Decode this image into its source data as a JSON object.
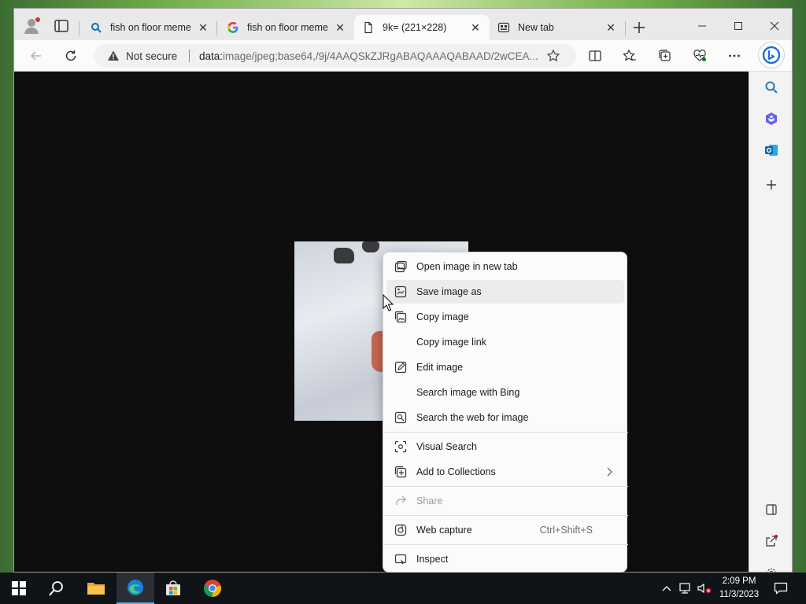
{
  "browser": {
    "tabs": [
      {
        "title": "fish on floor meme",
        "icon": "search-icon",
        "active": false
      },
      {
        "title": "fish on floor meme",
        "icon": "google-icon",
        "active": false
      },
      {
        "title": "9k= (221×228)",
        "icon": "page-icon",
        "active": true
      },
      {
        "title": "New tab",
        "icon": "new-tab-page-icon",
        "active": false
      }
    ],
    "address": {
      "security_label": "Not secure",
      "url_scheme": "data:",
      "url_rest": "image/jpeg;base64,/9j/4AAQSkZJRgABAQAAAQABAAD/2wCEA..."
    }
  },
  "context_menu": {
    "items": [
      {
        "label": "Open image in new tab",
        "icon": "open-in-new-tab-icon"
      },
      {
        "label": "Save image as",
        "icon": "save-image-icon",
        "hover": true
      },
      {
        "label": "Copy image",
        "icon": "copy-image-icon"
      },
      {
        "label": "Copy image link",
        "icon": ""
      },
      {
        "label": "Edit image",
        "icon": "edit-image-icon"
      },
      {
        "label": "Search image with Bing",
        "icon": ""
      },
      {
        "label": "Search the web for image",
        "icon": "search-web-image-icon"
      },
      {
        "label": "Visual Search",
        "icon": "visual-search-icon"
      },
      {
        "label": "Add to Collections",
        "icon": "collections-icon",
        "submenu": true
      },
      {
        "label": "Share",
        "icon": "share-icon",
        "disabled": true
      },
      {
        "label": "Web capture",
        "icon": "web-capture-icon",
        "shortcut": "Ctrl+Shift+S"
      },
      {
        "label": "Inspect",
        "icon": "inspect-icon"
      }
    ]
  },
  "taskbar": {
    "time": "2:09 PM",
    "date": "11/3/2023",
    "apps": [
      "start-icon",
      "search-icon",
      "file-explorer-icon",
      "edge-icon",
      "store-icon",
      "chrome-icon"
    ]
  },
  "colors": {
    "accent": "#0078d4",
    "page_background": "#0e0e0e",
    "taskbar": "#101317"
  }
}
